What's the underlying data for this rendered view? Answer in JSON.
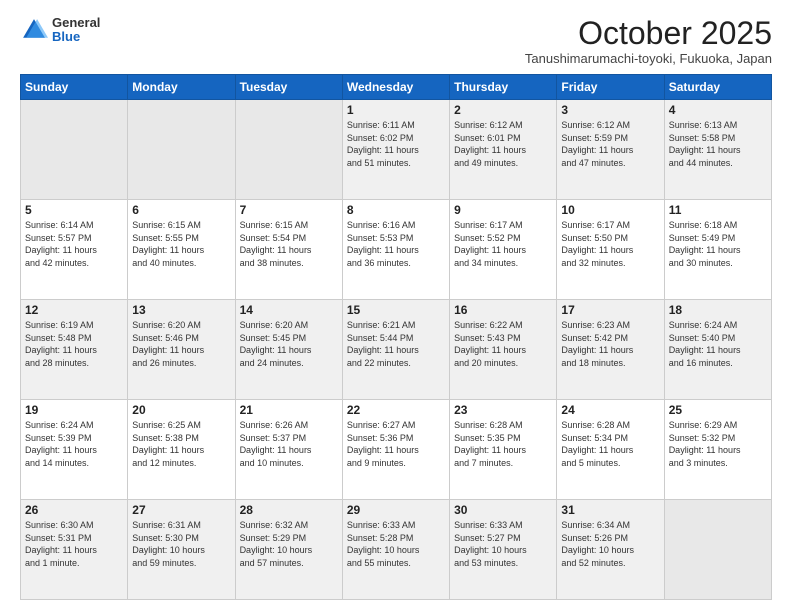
{
  "logo": {
    "general": "General",
    "blue": "Blue"
  },
  "header": {
    "month": "October 2025",
    "location": "Tanushimarumachi-toyoki, Fukuoka, Japan"
  },
  "weekdays": [
    "Sunday",
    "Monday",
    "Tuesday",
    "Wednesday",
    "Thursday",
    "Friday",
    "Saturday"
  ],
  "weeks": [
    [
      {
        "day": "",
        "info": ""
      },
      {
        "day": "",
        "info": ""
      },
      {
        "day": "",
        "info": ""
      },
      {
        "day": "1",
        "info": "Sunrise: 6:11 AM\nSunset: 6:02 PM\nDaylight: 11 hours\nand 51 minutes."
      },
      {
        "day": "2",
        "info": "Sunrise: 6:12 AM\nSunset: 6:01 PM\nDaylight: 11 hours\nand 49 minutes."
      },
      {
        "day": "3",
        "info": "Sunrise: 6:12 AM\nSunset: 5:59 PM\nDaylight: 11 hours\nand 47 minutes."
      },
      {
        "day": "4",
        "info": "Sunrise: 6:13 AM\nSunset: 5:58 PM\nDaylight: 11 hours\nand 44 minutes."
      }
    ],
    [
      {
        "day": "5",
        "info": "Sunrise: 6:14 AM\nSunset: 5:57 PM\nDaylight: 11 hours\nand 42 minutes."
      },
      {
        "day": "6",
        "info": "Sunrise: 6:15 AM\nSunset: 5:55 PM\nDaylight: 11 hours\nand 40 minutes."
      },
      {
        "day": "7",
        "info": "Sunrise: 6:15 AM\nSunset: 5:54 PM\nDaylight: 11 hours\nand 38 minutes."
      },
      {
        "day": "8",
        "info": "Sunrise: 6:16 AM\nSunset: 5:53 PM\nDaylight: 11 hours\nand 36 minutes."
      },
      {
        "day": "9",
        "info": "Sunrise: 6:17 AM\nSunset: 5:52 PM\nDaylight: 11 hours\nand 34 minutes."
      },
      {
        "day": "10",
        "info": "Sunrise: 6:17 AM\nSunset: 5:50 PM\nDaylight: 11 hours\nand 32 minutes."
      },
      {
        "day": "11",
        "info": "Sunrise: 6:18 AM\nSunset: 5:49 PM\nDaylight: 11 hours\nand 30 minutes."
      }
    ],
    [
      {
        "day": "12",
        "info": "Sunrise: 6:19 AM\nSunset: 5:48 PM\nDaylight: 11 hours\nand 28 minutes."
      },
      {
        "day": "13",
        "info": "Sunrise: 6:20 AM\nSunset: 5:46 PM\nDaylight: 11 hours\nand 26 minutes."
      },
      {
        "day": "14",
        "info": "Sunrise: 6:20 AM\nSunset: 5:45 PM\nDaylight: 11 hours\nand 24 minutes."
      },
      {
        "day": "15",
        "info": "Sunrise: 6:21 AM\nSunset: 5:44 PM\nDaylight: 11 hours\nand 22 minutes."
      },
      {
        "day": "16",
        "info": "Sunrise: 6:22 AM\nSunset: 5:43 PM\nDaylight: 11 hours\nand 20 minutes."
      },
      {
        "day": "17",
        "info": "Sunrise: 6:23 AM\nSunset: 5:42 PM\nDaylight: 11 hours\nand 18 minutes."
      },
      {
        "day": "18",
        "info": "Sunrise: 6:24 AM\nSunset: 5:40 PM\nDaylight: 11 hours\nand 16 minutes."
      }
    ],
    [
      {
        "day": "19",
        "info": "Sunrise: 6:24 AM\nSunset: 5:39 PM\nDaylight: 11 hours\nand 14 minutes."
      },
      {
        "day": "20",
        "info": "Sunrise: 6:25 AM\nSunset: 5:38 PM\nDaylight: 11 hours\nand 12 minutes."
      },
      {
        "day": "21",
        "info": "Sunrise: 6:26 AM\nSunset: 5:37 PM\nDaylight: 11 hours\nand 10 minutes."
      },
      {
        "day": "22",
        "info": "Sunrise: 6:27 AM\nSunset: 5:36 PM\nDaylight: 11 hours\nand 9 minutes."
      },
      {
        "day": "23",
        "info": "Sunrise: 6:28 AM\nSunset: 5:35 PM\nDaylight: 11 hours\nand 7 minutes."
      },
      {
        "day": "24",
        "info": "Sunrise: 6:28 AM\nSunset: 5:34 PM\nDaylight: 11 hours\nand 5 minutes."
      },
      {
        "day": "25",
        "info": "Sunrise: 6:29 AM\nSunset: 5:32 PM\nDaylight: 11 hours\nand 3 minutes."
      }
    ],
    [
      {
        "day": "26",
        "info": "Sunrise: 6:30 AM\nSunset: 5:31 PM\nDaylight: 11 hours\nand 1 minute."
      },
      {
        "day": "27",
        "info": "Sunrise: 6:31 AM\nSunset: 5:30 PM\nDaylight: 10 hours\nand 59 minutes."
      },
      {
        "day": "28",
        "info": "Sunrise: 6:32 AM\nSunset: 5:29 PM\nDaylight: 10 hours\nand 57 minutes."
      },
      {
        "day": "29",
        "info": "Sunrise: 6:33 AM\nSunset: 5:28 PM\nDaylight: 10 hours\nand 55 minutes."
      },
      {
        "day": "30",
        "info": "Sunrise: 6:33 AM\nSunset: 5:27 PM\nDaylight: 10 hours\nand 53 minutes."
      },
      {
        "day": "31",
        "info": "Sunrise: 6:34 AM\nSunset: 5:26 PM\nDaylight: 10 hours\nand 52 minutes."
      },
      {
        "day": "",
        "info": ""
      }
    ]
  ]
}
